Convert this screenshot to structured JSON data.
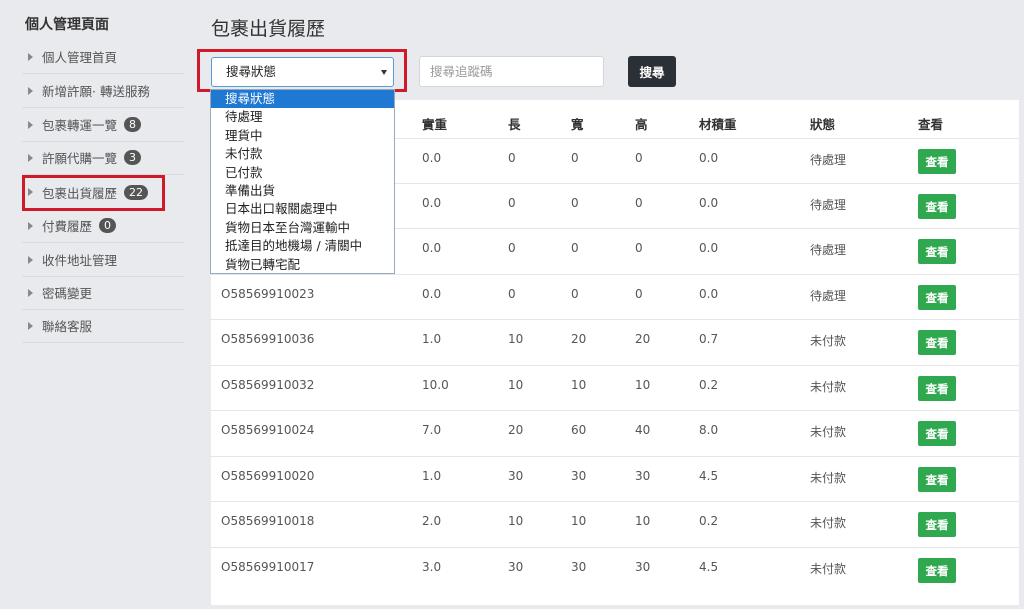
{
  "sidebar": {
    "title": "個人管理頁面",
    "items": [
      {
        "label": "個人管理首頁",
        "badge": null
      },
      {
        "label": "新增許願· 轉送服務",
        "badge": null
      },
      {
        "label": "包裹轉運一覽",
        "badge": "8"
      },
      {
        "label": "許願代購一覽",
        "badge": "3"
      },
      {
        "label": "包裹出貨履歷",
        "badge": "22"
      },
      {
        "label": "付費履歷",
        "badge": "0"
      },
      {
        "label": "收件地址管理",
        "badge": null
      },
      {
        "label": "密碼變更",
        "badge": null
      },
      {
        "label": "聯絡客服",
        "badge": null
      }
    ]
  },
  "page": {
    "title": "包裹出貨履歷"
  },
  "search": {
    "status_selected": "搜尋狀態",
    "tracking_placeholder": "搜尋追蹤碼",
    "button_label": "搜尋"
  },
  "dropdown": {
    "options": [
      "搜尋狀態",
      "待處理",
      "理貨中",
      "未付款",
      "已付款",
      "準備出貨",
      "日本出口報關處理中",
      "貨物日本至台灣運輸中",
      "抵達目的地機場 / 清關中",
      "貨物已轉宅配"
    ]
  },
  "table": {
    "headers": {
      "weight": "實重",
      "length": "長",
      "width": "寬",
      "height": "高",
      "volume": "材積重",
      "status": "狀態",
      "view": "查看"
    },
    "view_label": "查看",
    "rows": [
      {
        "id": "",
        "weight": "0.0",
        "length": "0",
        "width": "0",
        "height": "0",
        "volume": "0.0",
        "status": "待處理"
      },
      {
        "id": "",
        "weight": "0.0",
        "length": "0",
        "width": "0",
        "height": "0",
        "volume": "0.0",
        "status": "待處理"
      },
      {
        "id": "",
        "weight": "0.0",
        "length": "0",
        "width": "0",
        "height": "0",
        "volume": "0.0",
        "status": "待處理"
      },
      {
        "id": "O58569910023",
        "weight": "0.0",
        "length": "0",
        "width": "0",
        "height": "0",
        "volume": "0.0",
        "status": "待處理"
      },
      {
        "id": "O58569910036",
        "weight": "1.0",
        "length": "10",
        "width": "20",
        "height": "20",
        "volume": "0.7",
        "status": "未付款"
      },
      {
        "id": "O58569910032",
        "weight": "10.0",
        "length": "10",
        "width": "10",
        "height": "10",
        "volume": "0.2",
        "status": "未付款"
      },
      {
        "id": "O58569910024",
        "weight": "7.0",
        "length": "20",
        "width": "60",
        "height": "40",
        "volume": "8.0",
        "status": "未付款"
      },
      {
        "id": "O58569910020",
        "weight": "1.0",
        "length": "30",
        "width": "30",
        "height": "30",
        "volume": "4.5",
        "status": "未付款"
      },
      {
        "id": "O58569910018",
        "weight": "2.0",
        "length": "10",
        "width": "10",
        "height": "10",
        "volume": "0.2",
        "status": "未付款"
      },
      {
        "id": "O58569910017",
        "weight": "3.0",
        "length": "30",
        "width": "30",
        "height": "30",
        "volume": "4.5",
        "status": "未付款"
      }
    ]
  },
  "colors": {
    "accent_red": "#d01a2a",
    "view_green": "#2fa84f",
    "dark_button": "#2b2f36",
    "selected_blue": "#1f78d1"
  }
}
